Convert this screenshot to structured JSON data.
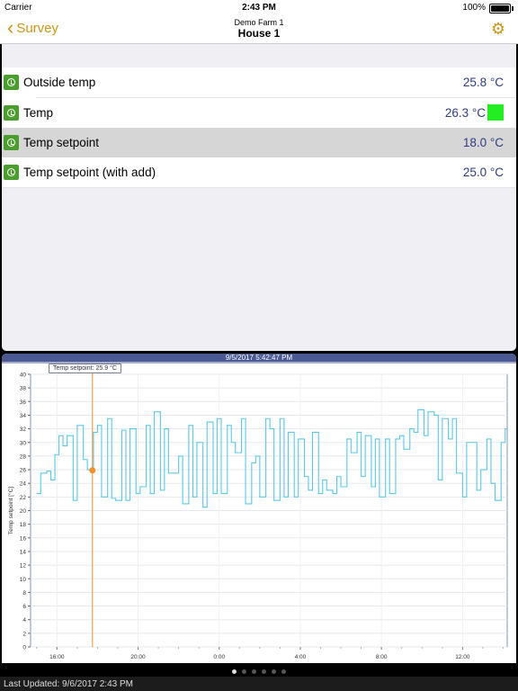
{
  "status_bar": {
    "carrier": "Carrier",
    "time": "2:43 PM",
    "battery": "100%"
  },
  "nav": {
    "back_label": "Survey",
    "subtitle": "Demo Farm 1",
    "title": "House 1",
    "settings_icon": "gear-icon",
    "accent_color": "#c9961a"
  },
  "list": {
    "items": [
      {
        "label": "Outside temp",
        "value": "25.8 °C",
        "selected": false,
        "indicator": ""
      },
      {
        "label": "Temp",
        "value": "26.3 °C",
        "selected": false,
        "indicator": "#22ee22"
      },
      {
        "label": "Temp setpoint",
        "value": "18.0 °C",
        "selected": true,
        "indicator": ""
      },
      {
        "label": "Temp setpoint (with add)",
        "value": "25.0 °C",
        "selected": false,
        "indicator": ""
      }
    ],
    "icon": "history-icon"
  },
  "chart": {
    "header": "9/5/2017 5:42:47 PM",
    "tooltip": "Temp setpoint: 25.9 °C"
  },
  "chart_data": {
    "type": "line",
    "ylabel": "Temp setpoint [°C]",
    "xlabel": "",
    "ylim": [
      0,
      40
    ],
    "yticks": [
      0,
      2,
      4,
      6,
      8,
      10,
      12,
      14,
      16,
      18,
      20,
      22,
      24,
      26,
      28,
      30,
      32,
      34,
      36,
      38,
      40
    ],
    "xticks": [
      "16:00",
      "20:00",
      "0:00",
      "4:00",
      "8:00",
      "12:00"
    ],
    "xtick_hours": [
      16,
      20,
      24,
      28,
      32,
      36
    ],
    "xlim_hours": [
      14.7,
      38.2
    ],
    "grid": true,
    "line_color": "#5bc8e6",
    "marker": {
      "hour": 17.75,
      "value": 25.9,
      "color": "#f0902a"
    },
    "series": [
      {
        "step": "post",
        "x": [
          15.0,
          15.2,
          15.5,
          15.7,
          15.9,
          16.1,
          16.3,
          16.5,
          16.8,
          17.0,
          17.3,
          17.5,
          17.8,
          18.0,
          18.2,
          18.5,
          18.7,
          18.9,
          19.2,
          19.4,
          19.6,
          19.9,
          20.1,
          20.4,
          20.6,
          20.8,
          21.1,
          21.3,
          21.5,
          21.8,
          22.0,
          22.2,
          22.5,
          22.7,
          22.9,
          23.2,
          23.4,
          23.7,
          23.9,
          24.1,
          24.4,
          24.6,
          24.8,
          25.1,
          25.3,
          25.6,
          25.8,
          26.0,
          26.3,
          26.5,
          26.7,
          27.0,
          27.2,
          27.4,
          27.7,
          27.9,
          28.2,
          28.4,
          28.6,
          28.9,
          29.1,
          29.3,
          29.6,
          29.8,
          30.0,
          30.3,
          30.5,
          30.8,
          31.0,
          31.2,
          31.5,
          31.7,
          31.9,
          32.2,
          32.4,
          32.7,
          32.9,
          33.1,
          33.4,
          33.6,
          33.8,
          34.1,
          34.3,
          34.6,
          34.8,
          35.0,
          35.3,
          35.5,
          35.7,
          36.0,
          36.2,
          36.4,
          36.7,
          36.9,
          37.2,
          37.4,
          37.6,
          37.9,
          38.1
        ],
        "y": [
          22.5,
          25.5,
          25.8,
          24.5,
          28.2,
          31.0,
          29.5,
          31.0,
          21.5,
          32.5,
          27.5,
          26.0,
          31.5,
          32.5,
          22.0,
          33.5,
          21.8,
          21.5,
          31.8,
          21.5,
          32.0,
          22.5,
          23.5,
          32.5,
          22.5,
          34.5,
          23.0,
          32.0,
          25.5,
          25.5,
          28.0,
          21.0,
          32.5,
          22.0,
          30.0,
          20.5,
          33.0,
          22.5,
          33.5,
          22.5,
          32.5,
          30.0,
          28.5,
          33.5,
          21.0,
          27.0,
          28.0,
          22.0,
          33.5,
          32.0,
          21.5,
          33.5,
          22.0,
          31.5,
          22.0,
          30.5,
          25.0,
          23.0,
          31.5,
          22.5,
          24.5,
          23.0,
          22.5,
          25.0,
          23.5,
          30.5,
          28.5,
          31.5,
          25.0,
          31.0,
          23.5,
          30.5,
          22.0,
          30.5,
          22.5,
          30.5,
          31.0,
          29.0,
          32.0,
          31.5,
          34.8,
          31.0,
          34.5,
          34.0,
          24.5,
          33.5,
          30.5,
          33.5,
          25.5,
          22.0,
          30.0,
          30.0,
          23.0,
          26.0,
          30.5,
          24.0,
          21.5,
          30.0,
          32.0
        ]
      }
    ]
  },
  "pager": {
    "count": 6,
    "active": 0
  },
  "footer": {
    "text": "Last Updated: 9/6/2017 2:43 PM"
  }
}
